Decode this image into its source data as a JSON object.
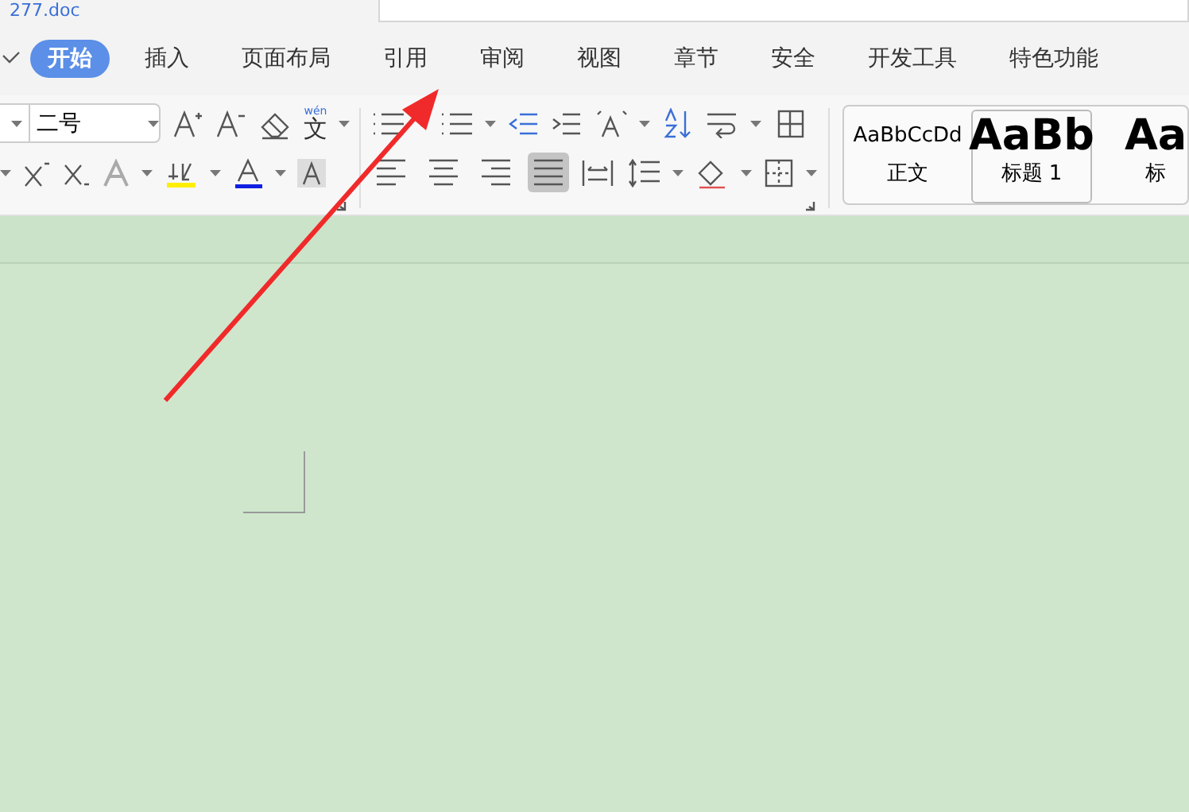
{
  "document_tab": {
    "title": "277.doc"
  },
  "menu_tabs": [
    {
      "label": "开始",
      "selected": true
    },
    {
      "label": "插入",
      "selected": false
    },
    {
      "label": "页面布局",
      "selected": false
    },
    {
      "label": "引用",
      "selected": false
    },
    {
      "label": "审阅",
      "selected": false
    },
    {
      "label": "视图",
      "selected": false
    },
    {
      "label": "章节",
      "selected": false
    },
    {
      "label": "安全",
      "selected": false
    },
    {
      "label": "开发工具",
      "selected": false
    },
    {
      "label": "特色功能",
      "selected": false
    }
  ],
  "font_size": {
    "value": "二号"
  },
  "phonetic_guide": {
    "ruby": "wén",
    "glyph": "文"
  },
  "alignment": [
    {
      "selected": false
    },
    {
      "selected": false
    },
    {
      "selected": false
    },
    {
      "selected": true
    }
  ],
  "styles": [
    {
      "kind": "body",
      "sample": "AaBbCcDd",
      "name": "正文",
      "selected": false
    },
    {
      "kind": "heading",
      "sample": "AaBb",
      "name": "标题 1",
      "selected": true
    },
    {
      "kind": "heading",
      "sample": "Aa",
      "name": "标",
      "selected": false
    }
  ]
}
